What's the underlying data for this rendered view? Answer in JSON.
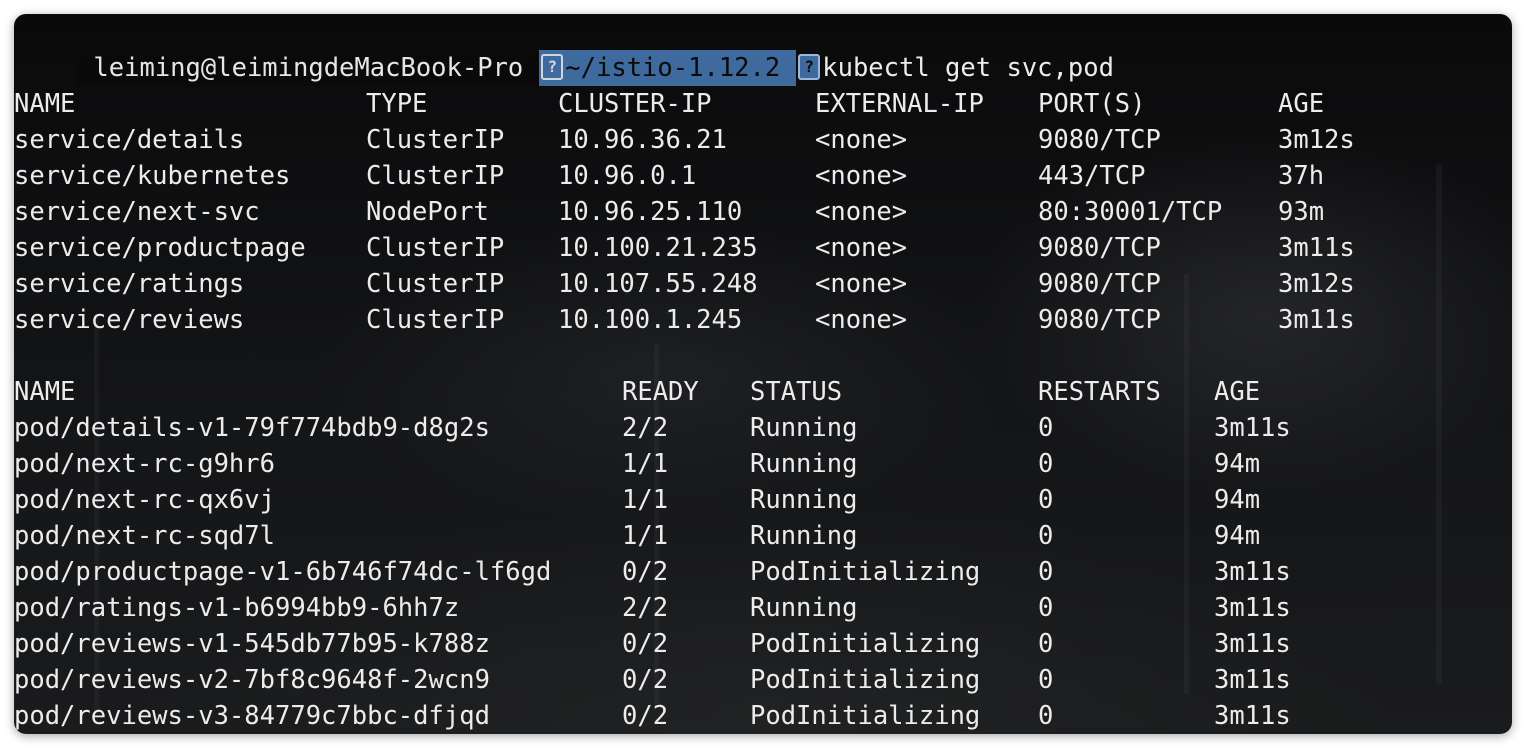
{
  "terminal": {
    "prompt": {
      "user_host": "leiming@leimingdeMacBook-Pro",
      "path": "~/istio-1.12.2",
      "command": "kubectl get svc,pod"
    },
    "services": {
      "headers": [
        "NAME",
        "TYPE",
        "CLUSTER-IP",
        "EXTERNAL-IP",
        "PORT(S)",
        "AGE"
      ],
      "rows": [
        [
          "service/details",
          "ClusterIP",
          "10.96.36.21",
          "<none>",
          "9080/TCP",
          "3m12s"
        ],
        [
          "service/kubernetes",
          "ClusterIP",
          "10.96.0.1",
          "<none>",
          "443/TCP",
          "37h"
        ],
        [
          "service/next-svc",
          "NodePort",
          "10.96.25.110",
          "<none>",
          "80:30001/TCP",
          "93m"
        ],
        [
          "service/productpage",
          "ClusterIP",
          "10.100.21.235",
          "<none>",
          "9080/TCP",
          "3m11s"
        ],
        [
          "service/ratings",
          "ClusterIP",
          "10.107.55.248",
          "<none>",
          "9080/TCP",
          "3m12s"
        ],
        [
          "service/reviews",
          "ClusterIP",
          "10.100.1.245",
          "<none>",
          "9080/TCP",
          "3m11s"
        ]
      ]
    },
    "pods": {
      "headers": [
        "NAME",
        "READY",
        "STATUS",
        "RESTARTS",
        "AGE"
      ],
      "rows": [
        [
          "pod/details-v1-79f774bdb9-d8g2s",
          "2/2",
          "Running",
          "0",
          "3m11s"
        ],
        [
          "pod/next-rc-g9hr6",
          "1/1",
          "Running",
          "0",
          "94m"
        ],
        [
          "pod/next-rc-qx6vj",
          "1/1",
          "Running",
          "0",
          "94m"
        ],
        [
          "pod/next-rc-sqd7l",
          "1/1",
          "Running",
          "0",
          "94m"
        ],
        [
          "pod/productpage-v1-6b746f74dc-lf6gd",
          "0/2",
          "PodInitializing",
          "0",
          "3m11s"
        ],
        [
          "pod/ratings-v1-b6994bb9-6hh7z",
          "2/2",
          "Running",
          "0",
          "3m11s"
        ],
        [
          "pod/reviews-v1-545db77b95-k788z",
          "0/2",
          "PodInitializing",
          "0",
          "3m11s"
        ],
        [
          "pod/reviews-v2-7bf8c9648f-2wcn9",
          "0/2",
          "PodInitializing",
          "0",
          "3m11s"
        ],
        [
          "pod/reviews-v3-84779c7bbc-dfjqd",
          "0/2",
          "PodInitializing",
          "0",
          "3m11s"
        ]
      ]
    }
  }
}
